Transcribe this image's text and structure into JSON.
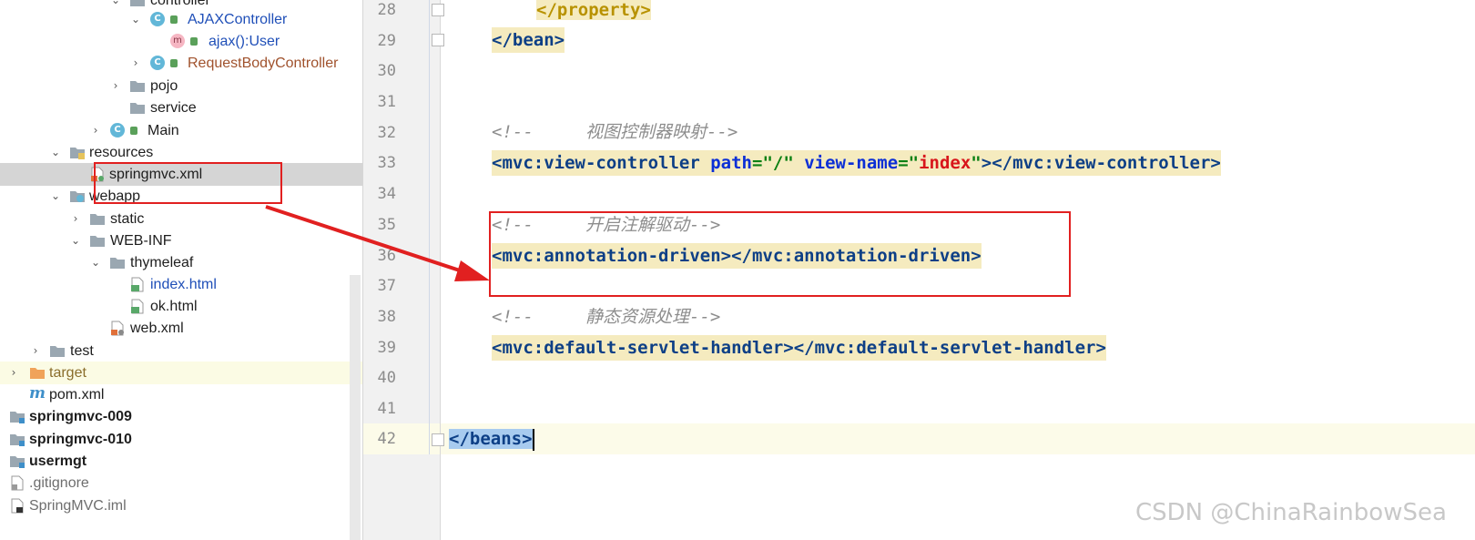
{
  "tree": {
    "items": [
      {
        "label": "controller",
        "icon": "folder-icon"
      },
      {
        "label": "AJAXController",
        "icon": "class-icon"
      },
      {
        "label": "ajax():User",
        "icon": "method-icon"
      },
      {
        "label": "RequestBodyController",
        "icon": "class-icon"
      },
      {
        "label": "pojo",
        "icon": "folder-icon"
      },
      {
        "label": "service",
        "icon": "folder-icon"
      },
      {
        "label": "Main",
        "icon": "class-icon"
      },
      {
        "label": "resources",
        "icon": "resources-folder-icon"
      },
      {
        "label": "springmvc.xml",
        "icon": "xml-file-icon"
      },
      {
        "label": "webapp",
        "icon": "web-folder-icon"
      },
      {
        "label": "static",
        "icon": "folder-icon"
      },
      {
        "label": "WEB-INF",
        "icon": "folder-icon"
      },
      {
        "label": "thymeleaf",
        "icon": "folder-icon"
      },
      {
        "label": "index.html",
        "icon": "html-file-icon"
      },
      {
        "label": "ok.html",
        "icon": "html-file-icon"
      },
      {
        "label": "web.xml",
        "icon": "xml-file-icon"
      },
      {
        "label": "test",
        "icon": "folder-icon"
      },
      {
        "label": "target",
        "icon": "excluded-folder-icon"
      },
      {
        "label": "pom.xml",
        "icon": "maven-icon"
      },
      {
        "label": "springmvc-009",
        "icon": "module-icon"
      },
      {
        "label": "springmvc-010",
        "icon": "module-icon"
      },
      {
        "label": "usermgt",
        "icon": "module-icon"
      },
      {
        "label": ".gitignore",
        "icon": "file-icon"
      },
      {
        "label": "SpringMVC.iml",
        "icon": "iml-file-icon"
      }
    ]
  },
  "editor": {
    "line_numbers": [
      "28",
      "29",
      "30",
      "31",
      "32",
      "33",
      "34",
      "35",
      "36",
      "37",
      "38",
      "39",
      "40",
      "41",
      "42"
    ],
    "line28": {
      "tag": "</property>"
    },
    "line29": {
      "tag": "</bean>"
    },
    "line32": {
      "open": "<!--",
      "text": "视图控制器映射",
      "close": "-->"
    },
    "line33": {
      "t1": "<mvc:view-controller",
      "a1": "path",
      "eq1": "=",
      "v1": "\"/\"",
      "a2": "view-name",
      "eq2": "=",
      "v2q1": "\"",
      "v2": "index",
      "v2q2": "\"",
      "t2": "></mvc:view-controller>"
    },
    "line35": {
      "open": "<!--",
      "text": "开启注解驱动",
      "close": "-->"
    },
    "line36": {
      "tag": "<mvc:annotation-driven></mvc:annotation-driven>"
    },
    "line38": {
      "open": "<!--",
      "text": "静态资源处理",
      "close": "-->"
    },
    "line39": {
      "tag": "<mvc:default-servlet-handler></mvc:default-servlet-handler>"
    },
    "line42": {
      "tag": "</beans>"
    }
  },
  "watermark": "CSDN @ChinaRainbowSea"
}
